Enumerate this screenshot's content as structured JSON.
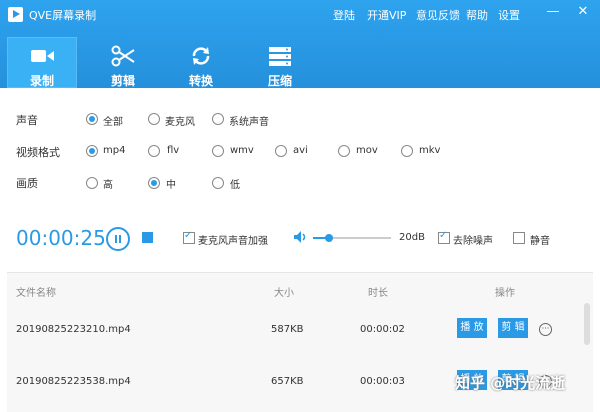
{
  "app": {
    "title": "QVE屏幕录制"
  },
  "top_links": [
    "登陆",
    "开通VIP",
    "意见反馈",
    "帮助",
    "设置"
  ],
  "window_controls": {
    "minimize": "—",
    "close": "✕"
  },
  "tabs": [
    {
      "label": "录制",
      "icon": "video-camera-icon"
    },
    {
      "label": "剪辑",
      "icon": "scissors-icon"
    },
    {
      "label": "转换",
      "icon": "convert-arrows-icon"
    },
    {
      "label": "压缩",
      "icon": "compress-icon"
    }
  ],
  "settings": {
    "audio": {
      "label": "声音",
      "options": [
        "全部",
        "麦克风",
        "系统声音"
      ],
      "selected": "全部"
    },
    "format": {
      "label": "视频格式",
      "options": [
        "mp4",
        "flv",
        "wmv",
        "avi",
        "mov",
        "mkv"
      ],
      "selected": "mp4"
    },
    "quality": {
      "label": "画质",
      "options": [
        "高",
        "中",
        "低"
      ],
      "selected": "中"
    }
  },
  "recorder": {
    "time": "00:00:25",
    "mic_boost_label": "麦克风声音加强",
    "volume_db": "20dB",
    "volume_level": 0.2,
    "denoise_label": "去除噪声",
    "mute_label": "静音"
  },
  "files": {
    "headers": {
      "name": "文件名称",
      "size": "大小",
      "duration": "时长",
      "actions": "操作"
    },
    "rows": [
      {
        "name": "20190825223210.mp4",
        "size": "587KB",
        "duration": "00:00:02"
      },
      {
        "name": "20190825223538.mp4",
        "size": "657KB",
        "duration": "00:00:03"
      }
    ],
    "play_label": "播 放",
    "edit_label": "剪 辑"
  },
  "watermark": "知乎 @时光流逝"
}
